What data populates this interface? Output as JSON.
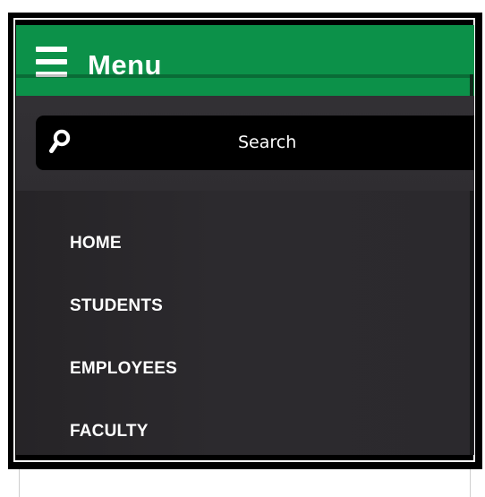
{
  "menu": {
    "title": "Menu",
    "hamburger_icon": "hamburger-icon",
    "colors": {
      "header": "#0c9149",
      "panel": "#2c2a2e",
      "text": "#ffffff",
      "search_background": "#000000"
    }
  },
  "search": {
    "icon": "search-icon",
    "label": "Search"
  },
  "items": [
    {
      "label": "HOME"
    },
    {
      "label": "STUDENTS"
    },
    {
      "label": "EMPLOYEES"
    },
    {
      "label": "FACULTY"
    }
  ]
}
